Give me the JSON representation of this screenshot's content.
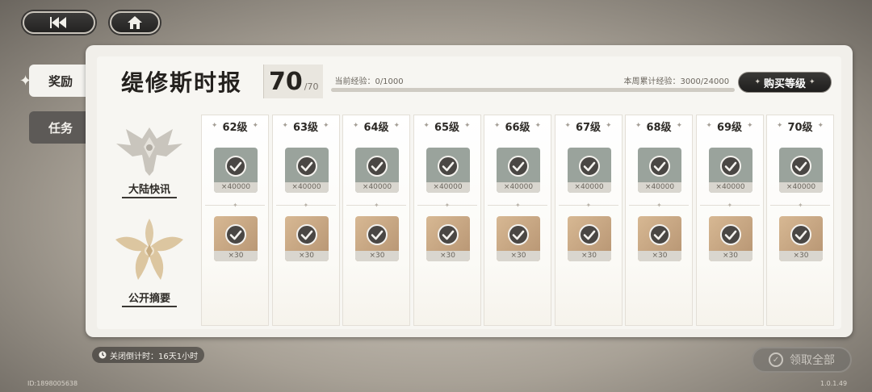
{
  "nav": {
    "back_icon": "rewind-icon",
    "home_icon": "home-icon"
  },
  "tabs": [
    {
      "label": "奖励",
      "active": true
    },
    {
      "label": "任务",
      "active": false
    }
  ],
  "header": {
    "title": "缇修斯时报",
    "level_current": "70",
    "level_max": "/70",
    "current_xp_label": "当前经验：0/1000",
    "weekly_xp_label": "本周累计经验：3000/24000",
    "buy_level_label": "购买等级"
  },
  "categories": [
    {
      "label": "大陆快讯",
      "icon": "eagle-crest-icon"
    },
    {
      "label": "公开摘要",
      "icon": "ornate-crest-icon"
    }
  ],
  "levels": [
    {
      "label": "62级",
      "free_qty": "×40000",
      "paid_qty": "×30"
    },
    {
      "label": "63级",
      "free_qty": "×40000",
      "paid_qty": "×30"
    },
    {
      "label": "64级",
      "free_qty": "×40000",
      "paid_qty": "×30"
    },
    {
      "label": "65级",
      "free_qty": "×40000",
      "paid_qty": "×30"
    },
    {
      "label": "66级",
      "free_qty": "×40000",
      "paid_qty": "×30"
    },
    {
      "label": "67级",
      "free_qty": "×40000",
      "paid_qty": "×30"
    },
    {
      "label": "68级",
      "free_qty": "×40000",
      "paid_qty": "×30"
    },
    {
      "label": "69级",
      "free_qty": "×40000",
      "paid_qty": "×30"
    },
    {
      "label": "70级",
      "free_qty": "×40000",
      "paid_qty": "×30"
    }
  ],
  "footer": {
    "timer_label": "关闭倒计时：16天1小时",
    "claim_all_label": "领取全部",
    "user_id": "ID:1898005638",
    "version": "1.0.1.49"
  },
  "colors": {
    "free_item_bg": "#9aa39c",
    "paid_item_bg": "#c9a57f",
    "accent_dark": "#24211e"
  }
}
